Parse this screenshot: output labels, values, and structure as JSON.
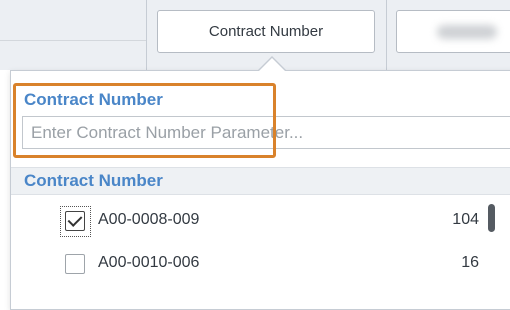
{
  "filter_strip": {
    "contract_button_label": "Contract Number"
  },
  "dropdown": {
    "parameter": {
      "label": "Contract Number",
      "input_value": "",
      "placeholder": "Enter Contract Number Parameter..."
    },
    "list": {
      "header": "Contract Number",
      "items": [
        {
          "label": "A00-0008-009",
          "count": "104",
          "checked": true
        },
        {
          "label": "A00-0010-006",
          "count": "16",
          "checked": false
        }
      ]
    }
  },
  "colors": {
    "label_blue": "#4a86c8",
    "highlight_orange": "#d9822b",
    "strip_bg": "#eceff3"
  }
}
